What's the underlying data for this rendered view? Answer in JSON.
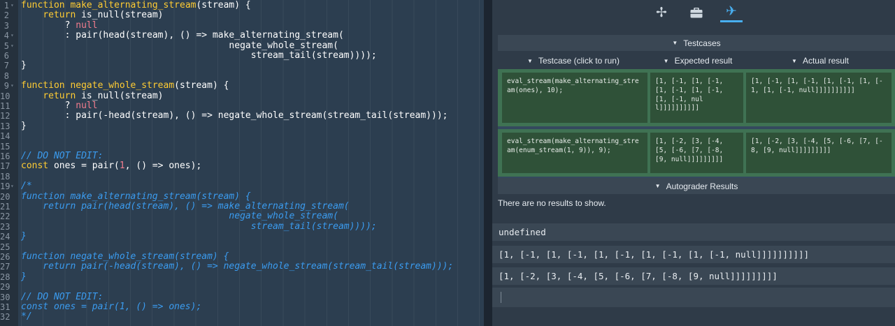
{
  "editor": {
    "lines": [
      {
        "n": "1",
        "fold": "▾",
        "code": [
          [
            "k",
            "function "
          ],
          [
            "f",
            "make_alternating_stream"
          ],
          [
            "p",
            "(stream) {"
          ]
        ]
      },
      {
        "n": "2",
        "fold": "",
        "code": [
          [
            "p",
            "    "
          ],
          [
            "k",
            "return "
          ],
          [
            "p",
            "is_null(stream)"
          ]
        ]
      },
      {
        "n": "3",
        "fold": "",
        "code": [
          [
            "p",
            "        ? "
          ],
          [
            "n",
            "null"
          ]
        ]
      },
      {
        "n": "4",
        "fold": "▾",
        "code": [
          [
            "p",
            "        : pair(head(stream), () => make_alternating_stream("
          ]
        ]
      },
      {
        "n": "5",
        "fold": "▾",
        "code": [
          [
            "p",
            "                                      negate_whole_stream("
          ]
        ]
      },
      {
        "n": "6",
        "fold": "",
        "code": [
          [
            "p",
            "                                          stream_tail(stream))));"
          ]
        ]
      },
      {
        "n": "7",
        "fold": "",
        "code": [
          [
            "p",
            "}"
          ]
        ]
      },
      {
        "n": "8",
        "fold": "",
        "code": [
          [
            "p",
            ""
          ]
        ]
      },
      {
        "n": "9",
        "fold": "▾",
        "code": [
          [
            "k",
            "function "
          ],
          [
            "f",
            "negate_whole_stream"
          ],
          [
            "p",
            "(stream) {"
          ]
        ]
      },
      {
        "n": "10",
        "fold": "",
        "code": [
          [
            "p",
            "    "
          ],
          [
            "k",
            "return "
          ],
          [
            "p",
            "is_null(stream)"
          ]
        ]
      },
      {
        "n": "11",
        "fold": "",
        "code": [
          [
            "p",
            "        ? "
          ],
          [
            "n",
            "null"
          ]
        ]
      },
      {
        "n": "12",
        "fold": "",
        "code": [
          [
            "p",
            "        : pair(-head(stream), () => negate_whole_stream(stream_tail(stream)));"
          ]
        ]
      },
      {
        "n": "13",
        "fold": "",
        "code": [
          [
            "p",
            "}"
          ]
        ]
      },
      {
        "n": "14",
        "fold": "",
        "code": [
          [
            "p",
            ""
          ]
        ]
      },
      {
        "n": "15",
        "fold": "",
        "code": [
          [
            "p",
            ""
          ]
        ]
      },
      {
        "n": "16",
        "fold": "",
        "code": [
          [
            "c",
            "// DO NOT EDIT:"
          ]
        ]
      },
      {
        "n": "17",
        "fold": "",
        "code": [
          [
            "k",
            "const "
          ],
          [
            "p",
            "ones = pair("
          ],
          [
            "n",
            "1"
          ],
          [
            "p",
            ", () => ones);"
          ]
        ]
      },
      {
        "n": "18",
        "fold": "",
        "code": [
          [
            "p",
            ""
          ]
        ]
      },
      {
        "n": "19",
        "fold": "▾",
        "code": [
          [
            "c",
            "/*"
          ]
        ]
      },
      {
        "n": "20",
        "fold": "",
        "code": [
          [
            "c",
            "function make_alternating_stream(stream) {"
          ]
        ]
      },
      {
        "n": "21",
        "fold": "",
        "code": [
          [
            "c",
            "    return pair(head(stream), () => make_alternating_stream("
          ]
        ]
      },
      {
        "n": "22",
        "fold": "",
        "code": [
          [
            "c",
            "                                      negate_whole_stream("
          ]
        ]
      },
      {
        "n": "23",
        "fold": "",
        "code": [
          [
            "c",
            "                                          stream_tail(stream))));"
          ]
        ]
      },
      {
        "n": "24",
        "fold": "",
        "code": [
          [
            "c",
            "}"
          ]
        ]
      },
      {
        "n": "25",
        "fold": "",
        "code": [
          [
            "p",
            ""
          ]
        ]
      },
      {
        "n": "26",
        "fold": "",
        "code": [
          [
            "c",
            "function negate_whole_stream(stream) {"
          ]
        ]
      },
      {
        "n": "27",
        "fold": "",
        "code": [
          [
            "c",
            "    return pair(-head(stream), () => negate_whole_stream(stream_tail(stream)));"
          ]
        ]
      },
      {
        "n": "28",
        "fold": "",
        "code": [
          [
            "c",
            "}"
          ]
        ]
      },
      {
        "n": "29",
        "fold": "",
        "code": [
          [
            "p",
            ""
          ]
        ]
      },
      {
        "n": "30",
        "fold": "",
        "code": [
          [
            "c",
            "// DO NOT EDIT:"
          ]
        ]
      },
      {
        "n": "31",
        "fold": "",
        "code": [
          [
            "c",
            "const ones = pair(1, () => ones);"
          ]
        ]
      },
      {
        "n": "32",
        "fold": "",
        "code": [
          [
            "c",
            "*/"
          ]
        ]
      }
    ]
  },
  "tabs": [
    {
      "name": "tab-settings",
      "icon": "pinwheel-icon",
      "glyph": "✢",
      "active": false
    },
    {
      "name": "tab-toolbox",
      "icon": "briefcase-icon",
      "glyph": "▰",
      "active": false
    },
    {
      "name": "tab-testcases",
      "icon": "airplane-icon",
      "glyph": "✈",
      "active": true
    }
  ],
  "testcases": {
    "header": "Testcases",
    "col_testcase": "Testcase (click to run)",
    "col_expected": "Expected result",
    "col_actual": "Actual result",
    "rows": [
      {
        "testcase": "eval_stream(make_alternating_stream(ones), 10);",
        "expected": "[1, [-1, [1, [-1, [1, [-1, [1, [-1, [1, [-1, null]]]]]]]]]]",
        "actual": "[1, [-1, [1, [-1, [1, [-1, [1, [-1, [1, [-1, null]]]]]]]]]]"
      },
      {
        "testcase": "eval_stream(make_alternating_stream(enum_stream(1, 9)), 9);",
        "expected": "[1, [-2, [3, [-4, [5, [-6, [7, [-8, [9, null]]]]]]]]]",
        "actual": "[1, [-2, [3, [-4, [5, [-6, [7, [-8, [9, null]]]]]]]]]"
      }
    ]
  },
  "autograder": {
    "header": "Autograder Results",
    "empty": "There are no results to show."
  },
  "repl": {
    "outputs": [
      "undefined",
      "[1, [-1, [1, [-1, [1, [-1, [1, [-1, [1, [-1, null]]]]]]]]]]",
      "[1, [-2, [3, [-4, [5, [-6, [7, [-8, [9, null]]]]]]]]]"
    ],
    "input_value": ""
  }
}
